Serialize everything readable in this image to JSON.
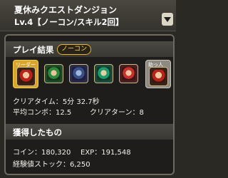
{
  "header": {
    "title": "夏休みクエストダンジョン",
    "subtitle": "Lv.4【ノーコン/スキル2回】"
  },
  "play_result": {
    "label": "プレイ結果",
    "badge": "ノーコン",
    "leader_tag": "リーダー",
    "friend_tag": "助っ人",
    "team_icons": [
      "leader-monster-icon",
      "monster-icon-2",
      "monster-icon-3",
      "monster-icon-4",
      "monster-icon-5",
      "friend-monster-icon"
    ],
    "clear_time_label": "クリアタイム：",
    "clear_time_value": "5分 32.7秒",
    "avg_combo_label": "平均コンボ：",
    "avg_combo_value": "12.5",
    "clear_turn_label": "クリアターン：",
    "clear_turn_value": "8"
  },
  "rewards": {
    "label": "獲得したもの",
    "coin_label": "コイン：",
    "coin_value": "180,320",
    "exp_label": "EXP：",
    "exp_value": "191,548",
    "stock_label": "経験値ストック：",
    "stock_value": "6,250"
  },
  "colors": {
    "accent_gold": "#e6b432",
    "background": "#2b2924"
  }
}
